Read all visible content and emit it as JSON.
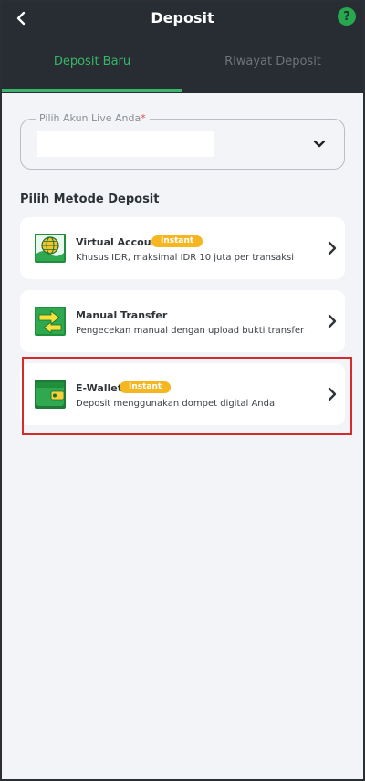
{
  "header": {
    "title": "Deposit",
    "back_icon": "chevron-left-icon",
    "help_icon": "question-icon",
    "help_label": "?"
  },
  "tabs": [
    {
      "label": "Deposit Baru",
      "active": true
    },
    {
      "label": "Riwayat Deposit",
      "active": false
    }
  ],
  "account_select": {
    "label": "Pilih Akun Live Anda",
    "required_mark": "*",
    "value": ""
  },
  "methods_title": "Pilih Metode Deposit",
  "methods": [
    {
      "name": "Virtual Account",
      "badge": "Instant",
      "description": "Khusus IDR, maksimal IDR 10 juta per transaksi",
      "icon": "globe-icon"
    },
    {
      "name": "Manual Transfer",
      "badge": "",
      "description": "Pengecekan manual dengan upload bukti transfer",
      "icon": "transfer-arrows-icon"
    },
    {
      "name": "E-Wallet",
      "badge": "Instant",
      "description": "Deposit menggunakan dompet digital Anda",
      "icon": "wallet-icon",
      "highlighted": true
    }
  ],
  "colors": {
    "header_bg": "#272d33",
    "accent_green": "#39b66a",
    "badge_yellow": "#f4b722",
    "highlight_red": "#d52b2b",
    "page_bg": "#f2f4f7"
  }
}
